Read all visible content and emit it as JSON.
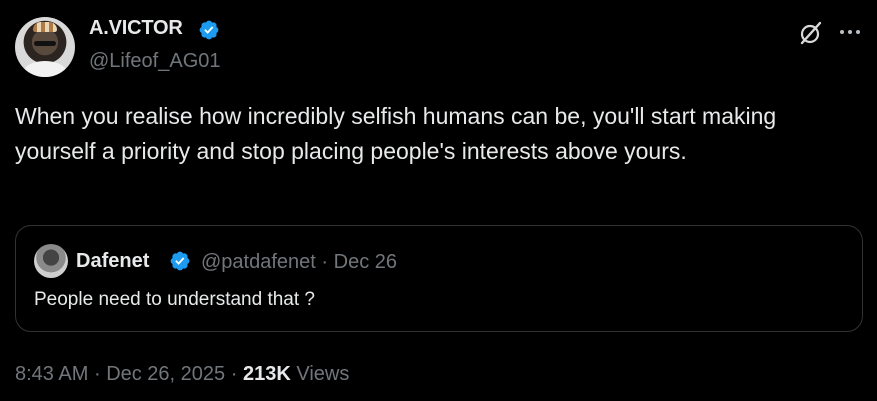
{
  "author": {
    "name": "A.VICTOR",
    "handle": "@Lifeof_AG01",
    "avatar_icon": "user-avatar"
  },
  "tweet": {
    "text": "When you realise how incredibly selfish humans can be, you'll start making yourself a priority and stop placing people's interests above yours."
  },
  "quoted": {
    "name": "Dafenet",
    "handle": "@patdafenet",
    "separator": "·",
    "date": "Dec 26",
    "text": "People need to understand that ?"
  },
  "footer": {
    "time": "8:43 AM",
    "separator1": "·",
    "date": "Dec 26, 2025",
    "separator2": "·",
    "views_count": "213K",
    "views_label": "Views"
  },
  "icons": {
    "verified": "verified-badge-icon",
    "grok": "grok-icon",
    "more": "more-icon"
  },
  "colors": {
    "background": "#000000",
    "text": "#e7e9ea",
    "muted": "#71767b",
    "verified": "#1d9bf0",
    "border": "#2f3336"
  }
}
